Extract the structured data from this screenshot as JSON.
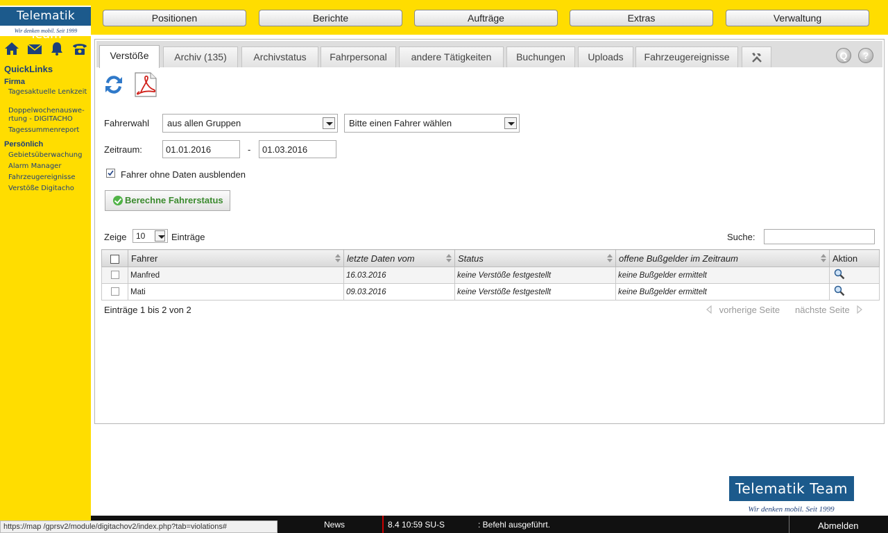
{
  "brand": {
    "name": "Telematik Team",
    "slogan": "Wir denken mobil. Seit 1999"
  },
  "quick_icons": [
    "home-icon",
    "mail-icon",
    "bell-icon",
    "phone-icon"
  ],
  "quicklinks": {
    "title": "QuickLinks",
    "sections": [
      {
        "title": "Firma",
        "links": [
          "Tagesaktuelle Lenkzeit",
          "Doppelwochenauswe-rtung - DIGITACHO",
          "Tagessummenreport"
        ]
      },
      {
        "title": "Persönlich",
        "links": [
          "Gebietsüberwachung",
          "Alarm Manager",
          "Fahrzeugereignisse",
          "Verstöße Digitacho"
        ]
      }
    ]
  },
  "topnav": {
    "positionen": "Positionen",
    "berichte": "Berichte",
    "auftraege": "Aufträge",
    "extras": "Extras",
    "verwaltung": "Verwaltung"
  },
  "tabs": [
    "Verstöße",
    "Archiv (135)",
    "Archivstatus",
    "Fahrpersonal",
    "andere Tätigkeiten",
    "Buchungen",
    "Uploads",
    "Fahrzeugereignisse"
  ],
  "active_tab": "Verstöße",
  "form": {
    "fahrerwahl_label": "Fahrerwahl",
    "group_select": "aus allen Gruppen",
    "driver_select": "Bitte einen Fahrer wählen",
    "zeitraum_label": "Zeitraum:",
    "date_from": "01.01.2016",
    "date_sep": "-",
    "date_to": "01.03.2016",
    "hide_label": "Fahrer ohne Daten ausblenden",
    "hide_checked": true,
    "calc_button": "Berechne Fahrerstatus"
  },
  "table_controls": {
    "show_label": "Zeige",
    "page_size": "10",
    "entries_label": "Einträge",
    "search_label": "Suche:",
    "search_value": ""
  },
  "table": {
    "columns": [
      "Fahrer",
      "letzte Daten vom",
      "Status",
      "offene Bußgelder im Zeitraum",
      "Aktion"
    ],
    "rows": [
      {
        "fahrer": "Manfred",
        "last": "16.03.2016",
        "status": "keine Verstöße festgestellt",
        "fines": "keine Bußgelder ermittelt"
      },
      {
        "fahrer": "Mati",
        "last": "09.03.2016",
        "status": "keine Verstöße festgestellt",
        "fines": "keine Bußgelder ermittelt"
      }
    ]
  },
  "pager": {
    "info": "Einträge 1 bis 2 von 2",
    "prev": "vorherige Seite",
    "next": "nächste Seite"
  },
  "statusbar": {
    "url": "https://map          /gprsv2/module/digitachov2/index.php?tab=violations#",
    "news": "News",
    "time": "8.4 10:59  SU-S",
    "message": ": Befehl ausgeführt.",
    "logout": "Abmelden"
  },
  "colors": {
    "brand_yellow": "#ffdd00",
    "brand_blue": "#1c5a8c",
    "link_blue": "#1c3f7a",
    "ok_green": "#51b347"
  }
}
